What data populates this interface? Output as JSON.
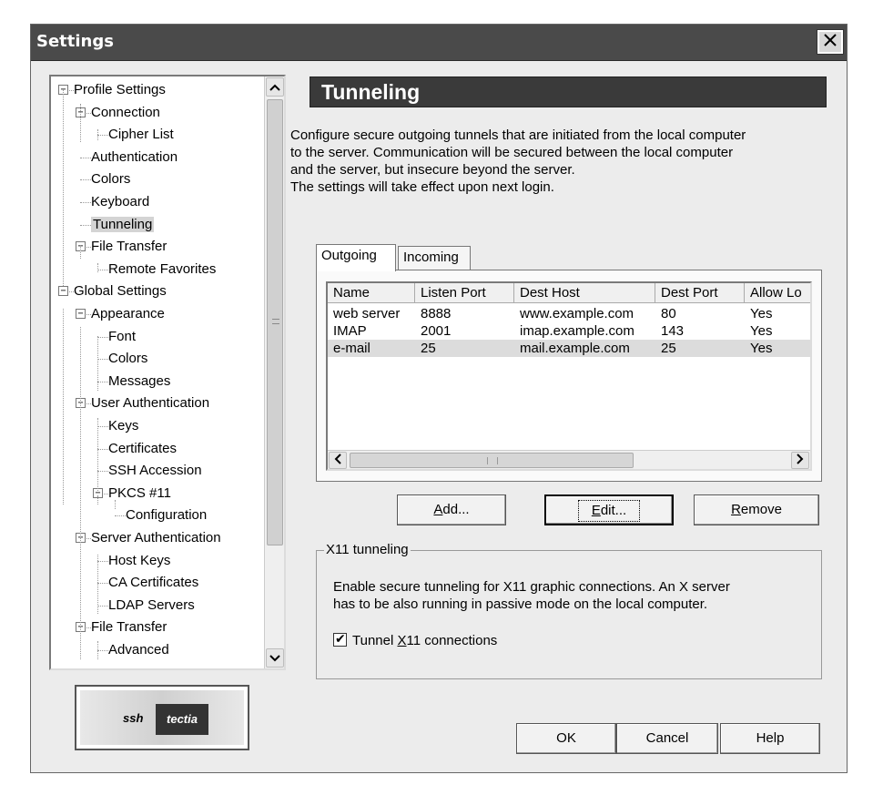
{
  "window": {
    "title": "Settings"
  },
  "tree": {
    "items": [
      {
        "label": "Profile Settings",
        "level": 0,
        "toggle": "−"
      },
      {
        "label": "Connection",
        "level": 1,
        "toggle": "−"
      },
      {
        "label": "Cipher List",
        "level": 2
      },
      {
        "label": "Authentication",
        "level": 1
      },
      {
        "label": "Colors",
        "level": 1
      },
      {
        "label": "Keyboard",
        "level": 1
      },
      {
        "label": "Tunneling",
        "level": 1,
        "selected": true
      },
      {
        "label": "File Transfer",
        "level": 1,
        "toggle": "−"
      },
      {
        "label": "Remote Favorites",
        "level": 2
      },
      {
        "label": "Global Settings",
        "level": 0,
        "toggle": "−"
      },
      {
        "label": "Appearance",
        "level": 1,
        "toggle": "−"
      },
      {
        "label": "Font",
        "level": 2
      },
      {
        "label": "Colors",
        "level": 2
      },
      {
        "label": "Messages",
        "level": 2
      },
      {
        "label": "User Authentication",
        "level": 1,
        "toggle": "−"
      },
      {
        "label": "Keys",
        "level": 2
      },
      {
        "label": "Certificates",
        "level": 2
      },
      {
        "label": "SSH Accession",
        "level": 2
      },
      {
        "label": "PKCS #11",
        "level": 2,
        "toggle": "−"
      },
      {
        "label": "Configuration",
        "level": 3
      },
      {
        "label": "Server Authentication",
        "level": 1,
        "toggle": "−"
      },
      {
        "label": "Host Keys",
        "level": 2
      },
      {
        "label": "CA Certificates",
        "level": 2
      },
      {
        "label": "LDAP Servers",
        "level": 2
      },
      {
        "label": "File Transfer",
        "level": 1,
        "toggle": "−"
      },
      {
        "label": "Advanced",
        "level": 2
      }
    ]
  },
  "logo": {
    "left": "ssh",
    "right": "tectia"
  },
  "section": {
    "title": "Tunneling",
    "description": [
      "Configure secure outgoing tunnels that are initiated from the local computer",
      "to the server. Communication will be secured between the local computer",
      "and the server, but insecure beyond the server.",
      "The settings will take effect upon next login."
    ]
  },
  "tabs": [
    {
      "label": "Outgoing",
      "active": true
    },
    {
      "label": "Incoming",
      "active": false
    }
  ],
  "table": {
    "columns": [
      "Name",
      "Listen Port",
      "Dest Host",
      "Dest Port",
      "Allow Lo"
    ],
    "rows": [
      [
        "web server",
        "8888",
        "www.example.com",
        "80",
        "Yes"
      ],
      [
        "IMAP",
        "2001",
        "imap.example.com",
        "143",
        "Yes"
      ],
      [
        "e-mail",
        "25",
        "mail.example.com",
        "25",
        "Yes"
      ]
    ],
    "selected_row": 2
  },
  "buttons": {
    "add": {
      "pre": "",
      "mn": "A",
      "post": "dd..."
    },
    "edit": {
      "pre": "",
      "mn": "E",
      "post": "dit..."
    },
    "remove": {
      "pre": "",
      "mn": "R",
      "post": "emove"
    },
    "ok": "OK",
    "cancel": "Cancel",
    "help": "Help"
  },
  "x11": {
    "legend": "X11 tunneling",
    "description": [
      "Enable secure tunneling for X11 graphic connections. An X server",
      "has to be also running in passive mode on the local computer."
    ],
    "checkbox": {
      "pre": "Tunnel ",
      "mn": "X",
      "post": "11 connections",
      "checked": true
    }
  }
}
